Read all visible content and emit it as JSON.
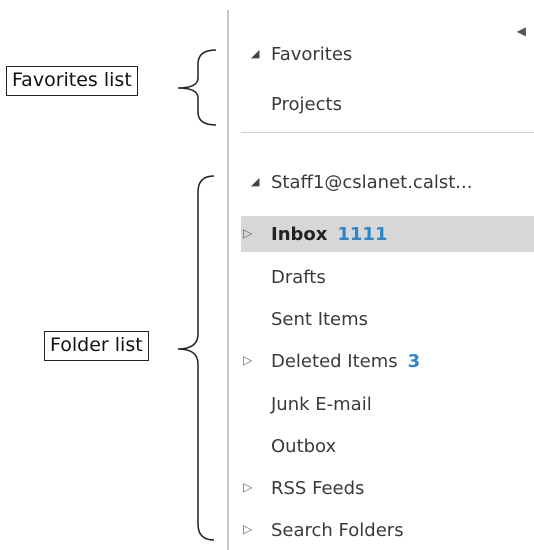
{
  "callouts": {
    "favorites": "Favorites list",
    "folders": "Folder list"
  },
  "favorites": {
    "header": "Favorites",
    "items": [
      {
        "label": "Projects"
      }
    ]
  },
  "account": {
    "header": "Staff1@cslanet.calst...",
    "folders": [
      {
        "label": "Inbox",
        "count": "1111",
        "expandable": true,
        "selected": true
      },
      {
        "label": "Drafts",
        "count": "",
        "expandable": false
      },
      {
        "label": "Sent Items",
        "count": "",
        "expandable": false
      },
      {
        "label": "Deleted Items",
        "count": "3",
        "expandable": true
      },
      {
        "label": "Junk E-mail",
        "count": "",
        "expandable": false
      },
      {
        "label": "Outbox",
        "count": "",
        "expandable": false
      },
      {
        "label": "RSS Feeds",
        "count": "",
        "expandable": true
      },
      {
        "label": "Search Folders",
        "count": "",
        "expandable": true
      }
    ]
  },
  "colors": {
    "count": "#2e86c9",
    "selected_bg": "#d7d7d7"
  },
  "icons": {
    "collapse_pane": "chevron-left-icon",
    "expanded": "triangle-down-icon",
    "collapsed": "triangle-right-icon"
  }
}
